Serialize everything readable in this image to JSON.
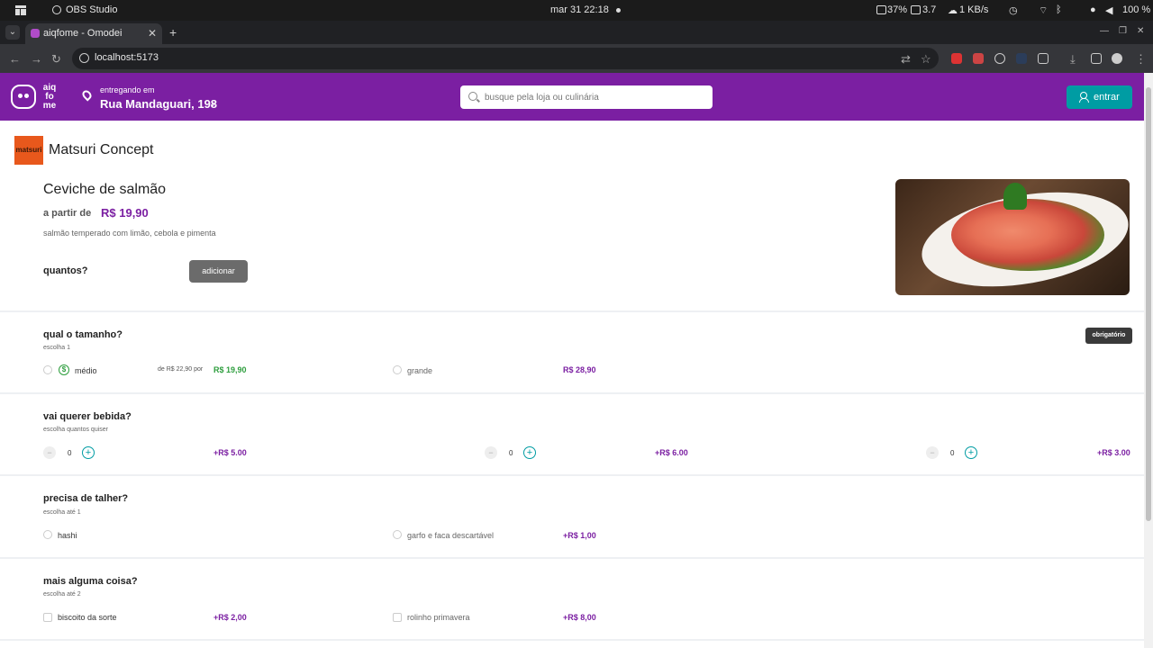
{
  "os": {
    "app_name": "OBS Studio",
    "clock": "mar 31  22:18",
    "cpu": "37%",
    "load": "3.7",
    "net": "1 KB/s",
    "battery": "100 %"
  },
  "browser": {
    "tab_title": "aiqfome - Omodei",
    "url": "localhost:5173"
  },
  "header": {
    "logo_text": "aiq fo me",
    "deliver_label": "entregando em",
    "address": "Rua Mandaguari, 198",
    "search_placeholder": "busque pela loja ou culinária",
    "login_label": "entrar"
  },
  "store": {
    "logo_text": "matsuri",
    "name": "Matsuri Concept"
  },
  "product": {
    "title": "Ceviche de salmão",
    "price_prefix": "a partir de",
    "price": "R$ 19,90",
    "description": "salmão temperado com limão, cebola e pimenta",
    "quantity_label": "quantos?",
    "add_label": "adicionar"
  },
  "sections": {
    "size": {
      "title": "qual o tamanho?",
      "subtitle": "escolha 1",
      "badge": "obrigatório",
      "options": [
        {
          "label": "médio",
          "old_price": "de R$ 22,90 por",
          "price": "R$ 19,90"
        },
        {
          "label": "grande",
          "price": "R$ 28,90"
        }
      ]
    },
    "drinks": {
      "title": "vai querer bebida?",
      "subtitle": "escolha quantos quiser",
      "items": [
        {
          "qty": "0",
          "price": "+R$ 5.00"
        },
        {
          "qty": "0",
          "price": "+R$ 6.00"
        },
        {
          "qty": "0",
          "price": "+R$ 3.00"
        }
      ]
    },
    "cutlery": {
      "title": "precisa de talher?",
      "subtitle": "escolha até 1",
      "options": [
        {
          "label": "hashi",
          "price": ""
        },
        {
          "label": "garfo e faca descartável",
          "price": "+R$ 1,00"
        }
      ]
    },
    "extras": {
      "title": "mais alguma coisa?",
      "subtitle": "escolha até 2",
      "options": [
        {
          "label": "biscoito da sorte",
          "price": "+R$ 2,00"
        },
        {
          "label": "rolinho primavera",
          "price": "+R$ 8,00"
        }
      ]
    }
  },
  "colors": {
    "brand_purple": "#7b1fa2",
    "teal": "#009ca3",
    "promo_green": "#2e9e3e"
  },
  "icons": [
    "search-icon",
    "user-icon",
    "location-pin-icon",
    "chevron-right-icon",
    "dollar-icon",
    "minus-icon",
    "plus-icon"
  ]
}
